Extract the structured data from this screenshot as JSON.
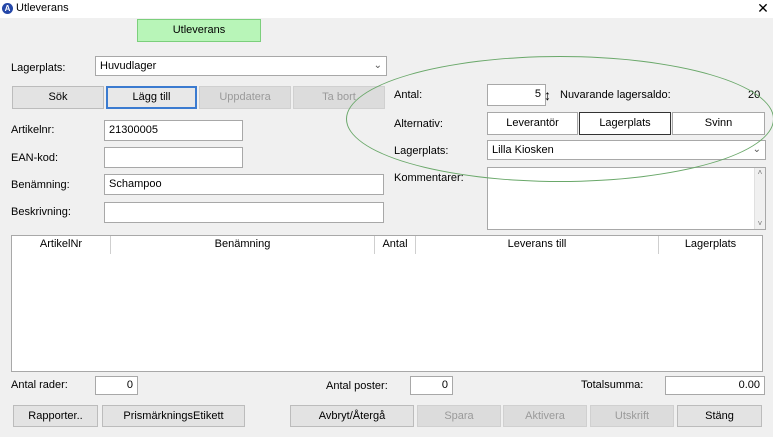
{
  "window": {
    "title": "Utleverans",
    "app_icon": "logo-icon",
    "close_glyph": "✕"
  },
  "banner": {
    "label": "Utleverans"
  },
  "left": {
    "lagerplats_label": "Lagerplats:",
    "lagerplats_value": "Huvudlager",
    "buttons": {
      "sok": "Sök",
      "lagg_till": "Lägg till",
      "uppdatera": "Uppdatera",
      "ta_bort": "Ta bort"
    },
    "artikelnr_label": "Artikelnr:",
    "artikelnr_value": "21300005",
    "ean_label": "EAN-kod:",
    "ean_value": "",
    "benamning_label": "Benämning:",
    "benamning_value": "Schampoo",
    "beskrivning_label": "Beskrivning:",
    "beskrivning_value": ""
  },
  "right": {
    "antal_label": "Antal:",
    "antal_value": "5",
    "saldo_label": "Nuvarande lagersaldo:",
    "saldo_value": "20",
    "alternativ_label": "Alternativ:",
    "alternativ_options": [
      "Leverantör",
      "Lagerplats",
      "Svinn"
    ],
    "alternativ_selected": "Lagerplats",
    "lagerplats_label": "Lagerplats:",
    "lagerplats_value": "Lilla Kiosken",
    "kommentarer_label": "Kommentarer:",
    "kommentarer_value": ""
  },
  "table": {
    "columns": [
      "ArtikelNr",
      "Benämning",
      "Antal",
      "Leverans till",
      "Lagerplats"
    ],
    "rows": []
  },
  "footer": {
    "antal_rader_label": "Antal rader:",
    "antal_rader_value": "0",
    "antal_poster_label": "Antal poster:",
    "antal_poster_value": "0",
    "totalsumma_label": "Totalsumma:",
    "totalsumma_value": "0.00",
    "buttons": {
      "rapporter": "Rapporter..",
      "prismarkning": "PrismärkningsEtikett",
      "avbryt": "Avbryt/Återgå",
      "spara": "Spara",
      "aktivera": "Aktivera",
      "utskrift": "Utskrift",
      "stang": "Stäng"
    }
  },
  "colors": {
    "banner": "#b8f5b8",
    "focus_border": "#3b7bd0",
    "annotation_ellipse": "#6aa86a"
  }
}
